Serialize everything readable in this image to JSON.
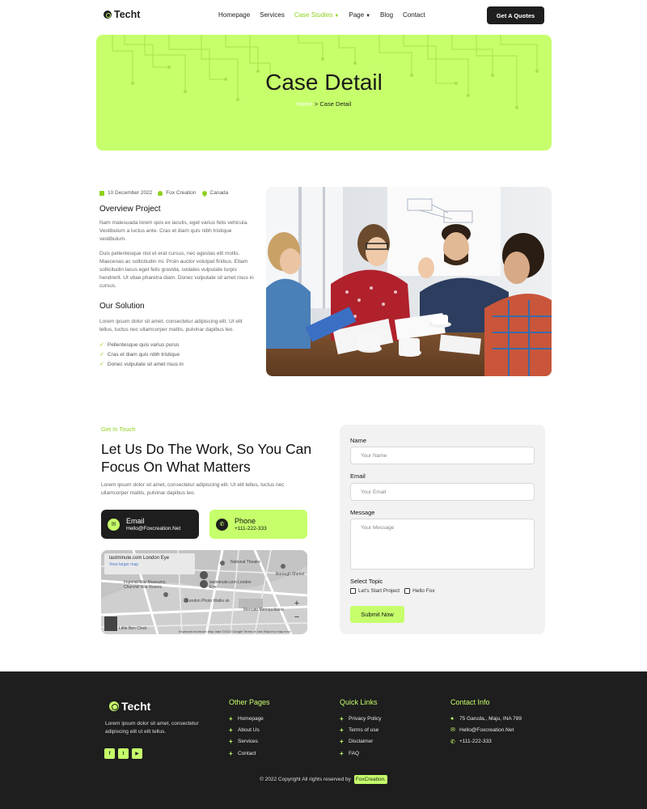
{
  "nav": {
    "logo_text": "Techt",
    "items": [
      {
        "label": "Homepage"
      },
      {
        "label": "Services"
      },
      {
        "label": "Case Studies"
      },
      {
        "label": "Page"
      },
      {
        "label": "Blog"
      },
      {
        "label": "Contact"
      }
    ],
    "cta_label": "Get A Quotes"
  },
  "hero": {
    "title": "Case Detail",
    "breadcrumb_home": "Home",
    "breadcrumb_separator": " > ",
    "breadcrumb_current": "Case Detail"
  },
  "case": {
    "meta_date": "10 December 2022",
    "meta_author": "Fox Creation",
    "meta_location": "Canada",
    "overview_title": "Overview Project",
    "overview_p1": "Nam malesuada lorem quis ex iaculis, eget varius felis vehicula. Vestibulum a luctus ante. Cras et diam quis nibh tristique vestibulum.",
    "overview_p2": "Duis pellentesque nisl et erat cursus, nec egestas elit mollis. Maecenas ac sollicitudin mi. Proin auctor volutpat finibus. Etiam sollicitudin lacus eget felis gravida, sodales vulputate turpis hendrerit. Ut vitae pharetra diam. Donec vulputate sit amet risus in cursus.",
    "solution_title": "Our Solution",
    "solution_p": "Lorem ipsum dolor sit amet, consectetur adipiscing elit. Ut elit tellus, luctus nec ullamcorper mattis, pulvinar dapibus leo.",
    "checklist": [
      "Pellentesque quis varius purus",
      "Cras et diam quis nibh tristique",
      "Donec vulputate sit amet risus in"
    ]
  },
  "contact": {
    "eyebrow": "Get In Touch",
    "heading": "Let Us Do The Work, So You Can Focus On What Matters",
    "paragraph": "Lorem ipsum dolor sit amet, consectetur adipiscing elit. Ut elit tellus, luctus nec ullamcorper mattis, pulvinar dapibus leo.",
    "email_title": "Email",
    "email_value": "Hello@Foxcreation.Net",
    "phone_title": "Phone",
    "phone_value": "+111-222-333",
    "map": {
      "place_title": "lastminute.com London Eye",
      "view_larger": "View larger map",
      "labels": [
        "National Theatre",
        "Imperial War Museums, Churchill War Rooms",
        "lastminute.com London Eye",
        "London Photo Walks uk",
        "Mercato Metropolitano",
        "Borough Market",
        "Little Ben Clock",
        "Keyboard shortcuts  Map data ©2022 Google  Terms of Use  Report a map error"
      ],
      "zoom_in": "+",
      "zoom_out": "−"
    }
  },
  "form": {
    "name_label": "Name",
    "name_placeholder": "Your Name",
    "email_label": "Email",
    "email_placeholder": "Your Email",
    "message_label": "Message",
    "message_placeholder": "Your Message",
    "topic_label": "Select Topic",
    "topic_options": [
      "Let's Start Project",
      "Hello Fox"
    ],
    "submit_label": "Submit Now"
  },
  "footer": {
    "logo_text": "Techt",
    "about": "Lorem ipsum dolor sit amet, consectetur adipiscing elit ut elit tellus.",
    "col_pages_title": "Other Pages",
    "pages": [
      "Homepage",
      "About Us",
      "Services",
      "Contact"
    ],
    "col_links_title": "Quick Links",
    "links": [
      "Privacy Policy",
      "Terms of use",
      "Disclaimer",
      "FAQ"
    ],
    "col_contact_title": "Contact Info",
    "address": "75 Garuda., Maju, INA 789",
    "email": "Hello@Foxcreation.Net",
    "phone": "+111-222-333",
    "copyright": "© 2022 Copyright All rights reserved by",
    "copyright_brand": "FoxCreation."
  },
  "colors": {
    "accent": "#c6ff6b",
    "accent_text": "#8ed11f",
    "dark": "#1e1e1e"
  }
}
